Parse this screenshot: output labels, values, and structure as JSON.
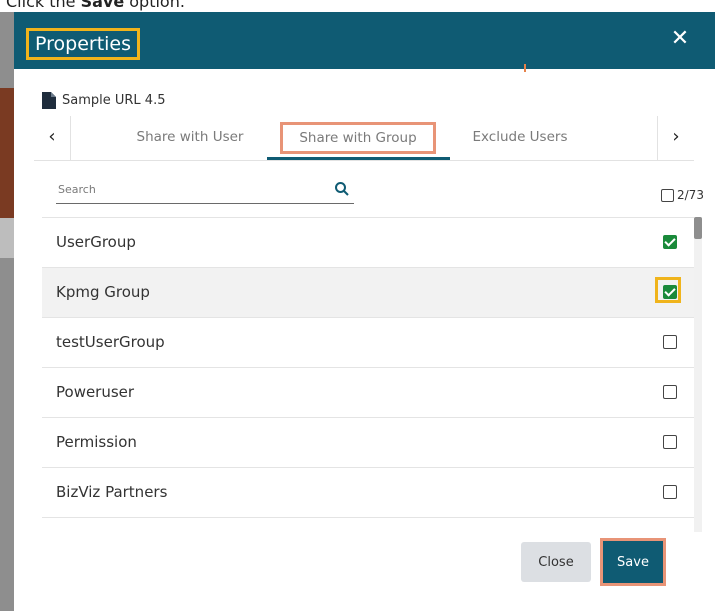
{
  "caption": {
    "prefix": "Click the ",
    "bold": "Save",
    "suffix": " option."
  },
  "dialog": {
    "title": "Properties"
  },
  "document": {
    "name": "Sample URL 4.5"
  },
  "tabs": [
    {
      "label": "Share with User"
    },
    {
      "label": "Share with Group",
      "active": true
    },
    {
      "label": "Exclude Users"
    }
  ],
  "search": {
    "placeholder": "Search"
  },
  "selection_count": "2/73",
  "groups": [
    {
      "name": "UserGroup",
      "checked": true
    },
    {
      "name": "Kpmg Group",
      "checked": true
    },
    {
      "name": "testUserGroup",
      "checked": false
    },
    {
      "name": "Poweruser",
      "checked": false
    },
    {
      "name": "Permission",
      "checked": false
    },
    {
      "name": "BizViz Partners",
      "checked": false
    }
  ],
  "buttons": {
    "close": "Close",
    "save": "Save"
  },
  "colors": {
    "header": "#0f5b73",
    "highlight_yellow": "#f0b41c",
    "highlight_salmon": "#e89477",
    "checked_green": "#1a8a3a"
  }
}
